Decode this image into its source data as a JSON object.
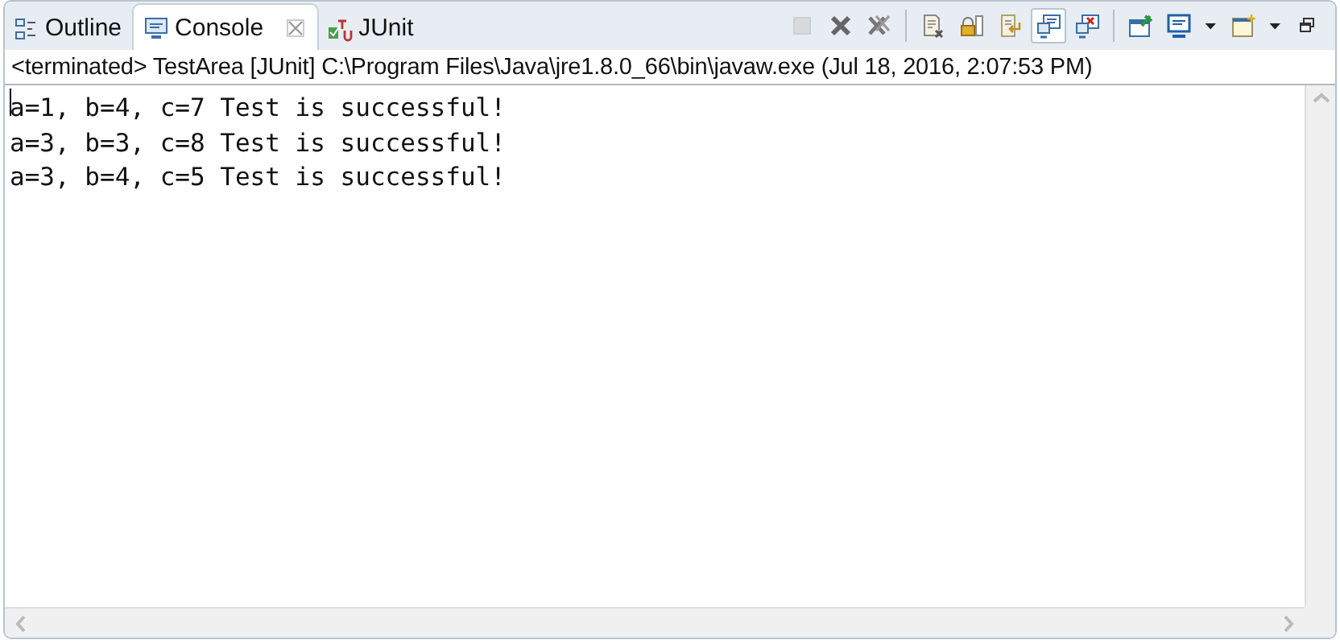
{
  "tabs": [
    {
      "label": "Outline",
      "kind": "outline",
      "selected": false,
      "closable": false
    },
    {
      "label": "Console",
      "kind": "console",
      "selected": true,
      "closable": true
    },
    {
      "label": "JUnit",
      "kind": "junit",
      "selected": false,
      "closable": false
    }
  ],
  "toolbar": [
    {
      "kind": "terminate",
      "disabled": true,
      "pressed": false
    },
    {
      "kind": "remove-launch",
      "disabled": false,
      "pressed": false
    },
    {
      "kind": "remove-all",
      "disabled": false,
      "pressed": false
    },
    {
      "kind": "separator"
    },
    {
      "kind": "clear",
      "disabled": false,
      "pressed": false
    },
    {
      "kind": "scroll-lock",
      "disabled": false,
      "pressed": false
    },
    {
      "kind": "word-wrap",
      "disabled": false,
      "pressed": false
    },
    {
      "kind": "show-stdout",
      "disabled": false,
      "pressed": true
    },
    {
      "kind": "show-stderr",
      "disabled": false,
      "pressed": false
    },
    {
      "kind": "separator"
    },
    {
      "kind": "pin",
      "disabled": false,
      "pressed": false
    },
    {
      "kind": "display",
      "disabled": false,
      "pressed": false
    },
    {
      "kind": "dropdown"
    },
    {
      "kind": "new-console",
      "disabled": false,
      "pressed": false
    },
    {
      "kind": "dropdown"
    },
    {
      "kind": "restore",
      "disabled": false,
      "pressed": false
    }
  ],
  "console": {
    "header": "<terminated> TestArea [JUnit] C:\\Program Files\\Java\\jre1.8.0_66\\bin\\javaw.exe (Jul 18, 2016, 2:07:53 PM)",
    "lines": [
      "a=1, b=4, c=7 Test is successful!",
      "a=3, b=3, c=8 Test is successful!",
      "a=3, b=4, c=5 Test is successful!"
    ]
  }
}
